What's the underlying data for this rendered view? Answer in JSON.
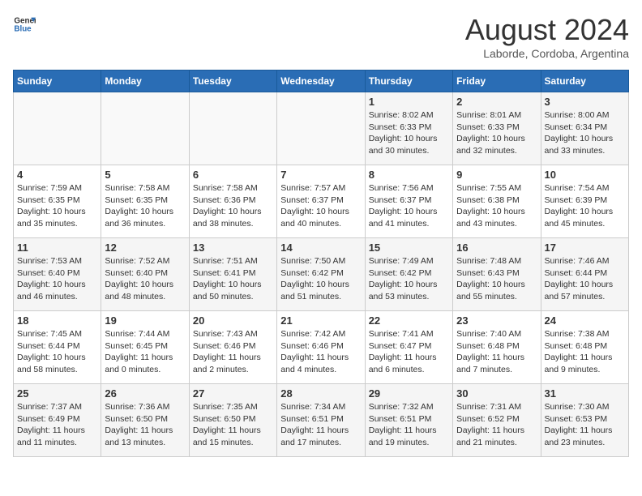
{
  "header": {
    "logo_general": "General",
    "logo_blue": "Blue",
    "title": "August 2024",
    "location": "Laborde, Cordoba, Argentina"
  },
  "weekdays": [
    "Sunday",
    "Monday",
    "Tuesday",
    "Wednesday",
    "Thursday",
    "Friday",
    "Saturday"
  ],
  "weeks": [
    [
      {
        "day": "",
        "info": ""
      },
      {
        "day": "",
        "info": ""
      },
      {
        "day": "",
        "info": ""
      },
      {
        "day": "",
        "info": ""
      },
      {
        "day": "1",
        "info": "Sunrise: 8:02 AM\nSunset: 6:33 PM\nDaylight: 10 hours\nand 30 minutes."
      },
      {
        "day": "2",
        "info": "Sunrise: 8:01 AM\nSunset: 6:33 PM\nDaylight: 10 hours\nand 32 minutes."
      },
      {
        "day": "3",
        "info": "Sunrise: 8:00 AM\nSunset: 6:34 PM\nDaylight: 10 hours\nand 33 minutes."
      }
    ],
    [
      {
        "day": "4",
        "info": "Sunrise: 7:59 AM\nSunset: 6:35 PM\nDaylight: 10 hours\nand 35 minutes."
      },
      {
        "day": "5",
        "info": "Sunrise: 7:58 AM\nSunset: 6:35 PM\nDaylight: 10 hours\nand 36 minutes."
      },
      {
        "day": "6",
        "info": "Sunrise: 7:58 AM\nSunset: 6:36 PM\nDaylight: 10 hours\nand 38 minutes."
      },
      {
        "day": "7",
        "info": "Sunrise: 7:57 AM\nSunset: 6:37 PM\nDaylight: 10 hours\nand 40 minutes."
      },
      {
        "day": "8",
        "info": "Sunrise: 7:56 AM\nSunset: 6:37 PM\nDaylight: 10 hours\nand 41 minutes."
      },
      {
        "day": "9",
        "info": "Sunrise: 7:55 AM\nSunset: 6:38 PM\nDaylight: 10 hours\nand 43 minutes."
      },
      {
        "day": "10",
        "info": "Sunrise: 7:54 AM\nSunset: 6:39 PM\nDaylight: 10 hours\nand 45 minutes."
      }
    ],
    [
      {
        "day": "11",
        "info": "Sunrise: 7:53 AM\nSunset: 6:40 PM\nDaylight: 10 hours\nand 46 minutes."
      },
      {
        "day": "12",
        "info": "Sunrise: 7:52 AM\nSunset: 6:40 PM\nDaylight: 10 hours\nand 48 minutes."
      },
      {
        "day": "13",
        "info": "Sunrise: 7:51 AM\nSunset: 6:41 PM\nDaylight: 10 hours\nand 50 minutes."
      },
      {
        "day": "14",
        "info": "Sunrise: 7:50 AM\nSunset: 6:42 PM\nDaylight: 10 hours\nand 51 minutes."
      },
      {
        "day": "15",
        "info": "Sunrise: 7:49 AM\nSunset: 6:42 PM\nDaylight: 10 hours\nand 53 minutes."
      },
      {
        "day": "16",
        "info": "Sunrise: 7:48 AM\nSunset: 6:43 PM\nDaylight: 10 hours\nand 55 minutes."
      },
      {
        "day": "17",
        "info": "Sunrise: 7:46 AM\nSunset: 6:44 PM\nDaylight: 10 hours\nand 57 minutes."
      }
    ],
    [
      {
        "day": "18",
        "info": "Sunrise: 7:45 AM\nSunset: 6:44 PM\nDaylight: 10 hours\nand 58 minutes."
      },
      {
        "day": "19",
        "info": "Sunrise: 7:44 AM\nSunset: 6:45 PM\nDaylight: 11 hours\nand 0 minutes."
      },
      {
        "day": "20",
        "info": "Sunrise: 7:43 AM\nSunset: 6:46 PM\nDaylight: 11 hours\nand 2 minutes."
      },
      {
        "day": "21",
        "info": "Sunrise: 7:42 AM\nSunset: 6:46 PM\nDaylight: 11 hours\nand 4 minutes."
      },
      {
        "day": "22",
        "info": "Sunrise: 7:41 AM\nSunset: 6:47 PM\nDaylight: 11 hours\nand 6 minutes."
      },
      {
        "day": "23",
        "info": "Sunrise: 7:40 AM\nSunset: 6:48 PM\nDaylight: 11 hours\nand 7 minutes."
      },
      {
        "day": "24",
        "info": "Sunrise: 7:38 AM\nSunset: 6:48 PM\nDaylight: 11 hours\nand 9 minutes."
      }
    ],
    [
      {
        "day": "25",
        "info": "Sunrise: 7:37 AM\nSunset: 6:49 PM\nDaylight: 11 hours\nand 11 minutes."
      },
      {
        "day": "26",
        "info": "Sunrise: 7:36 AM\nSunset: 6:50 PM\nDaylight: 11 hours\nand 13 minutes."
      },
      {
        "day": "27",
        "info": "Sunrise: 7:35 AM\nSunset: 6:50 PM\nDaylight: 11 hours\nand 15 minutes."
      },
      {
        "day": "28",
        "info": "Sunrise: 7:34 AM\nSunset: 6:51 PM\nDaylight: 11 hours\nand 17 minutes."
      },
      {
        "day": "29",
        "info": "Sunrise: 7:32 AM\nSunset: 6:51 PM\nDaylight: 11 hours\nand 19 minutes."
      },
      {
        "day": "30",
        "info": "Sunrise: 7:31 AM\nSunset: 6:52 PM\nDaylight: 11 hours\nand 21 minutes."
      },
      {
        "day": "31",
        "info": "Sunrise: 7:30 AM\nSunset: 6:53 PM\nDaylight: 11 hours\nand 23 minutes."
      }
    ]
  ]
}
